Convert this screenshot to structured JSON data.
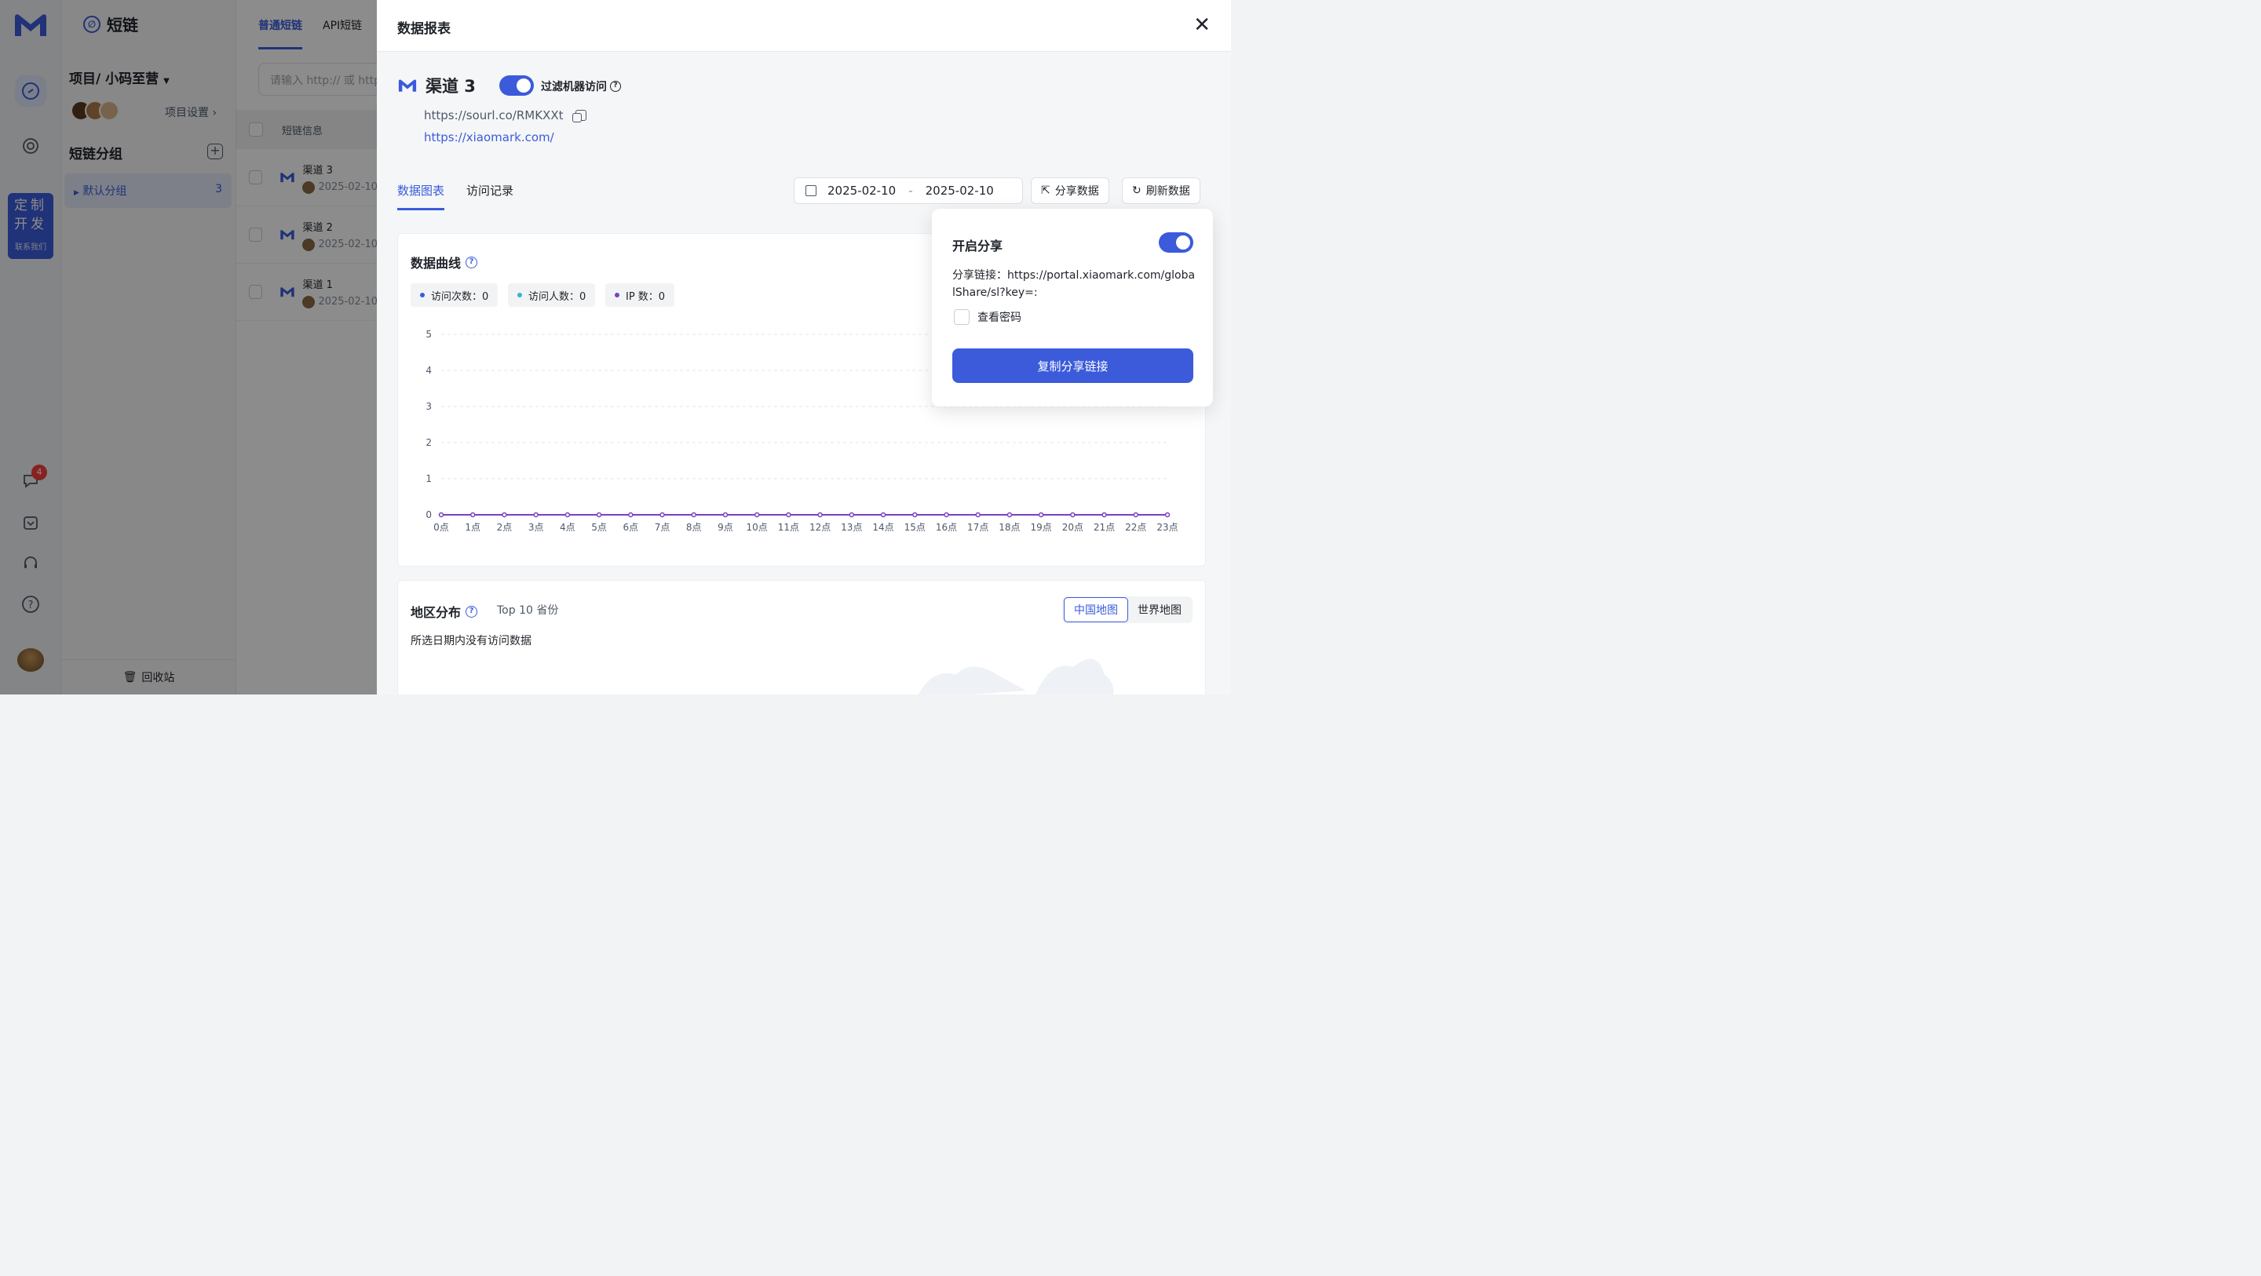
{
  "rail": {
    "custom_title": "定制开发",
    "custom_sub": "联系我们",
    "notification_count": "4"
  },
  "project_panel": {
    "brand": "短链",
    "project_title": "项目/ 小码至营",
    "project_settings": "项目设置",
    "groups_title": "短链分组",
    "default_group": {
      "label": "默认分组",
      "count": "3"
    },
    "trash": "回收站"
  },
  "link_list": {
    "tabs": [
      "普通短链",
      "API短链"
    ],
    "search_placeholder": "请输入 http:// 或 https://",
    "header": "短链信息",
    "rows": [
      {
        "name": "渠道 3",
        "date": "2025-02-10"
      },
      {
        "name": "渠道 2",
        "date": "2025-02-10"
      },
      {
        "name": "渠道 1",
        "date": "2025-02-10"
      }
    ]
  },
  "drawer": {
    "title": "数据报表",
    "link_name": "渠道 3",
    "filter_label": "过滤机器访问",
    "short_url": "https://sourl.co/RMKXXt",
    "target_url": "https://xiaomark.com/",
    "tabs": [
      "数据图表",
      "访问记录"
    ],
    "date_start": "2025-02-10",
    "date_sep": "-",
    "date_end": "2025-02-10",
    "share_button": "分享数据",
    "refresh_button": "刷新数据"
  },
  "curve_card": {
    "title": "数据曲线",
    "legend": [
      {
        "label": "访问次数：0",
        "color": "#3b5bdb"
      },
      {
        "label": "访问人数：0",
        "color": "#36b6c9"
      },
      {
        "label": "IP 数：0",
        "color": "#7b3fc4"
      }
    ]
  },
  "chart_data": {
    "type": "line",
    "x": [
      "0点",
      "1点",
      "2点",
      "3点",
      "4点",
      "5点",
      "6点",
      "7点",
      "8点",
      "9点",
      "10点",
      "11点",
      "12点",
      "13点",
      "14点",
      "15点",
      "16点",
      "17点",
      "18点",
      "19点",
      "20点",
      "21点",
      "22点",
      "23点"
    ],
    "series": [
      {
        "name": "访问次数",
        "values": [
          0,
          0,
          0,
          0,
          0,
          0,
          0,
          0,
          0,
          0,
          0,
          0,
          0,
          0,
          0,
          0,
          0,
          0,
          0,
          0,
          0,
          0,
          0,
          0
        ]
      },
      {
        "name": "访问人数",
        "values": [
          0,
          0,
          0,
          0,
          0,
          0,
          0,
          0,
          0,
          0,
          0,
          0,
          0,
          0,
          0,
          0,
          0,
          0,
          0,
          0,
          0,
          0,
          0,
          0
        ]
      },
      {
        "name": "IP 数",
        "values": [
          0,
          0,
          0,
          0,
          0,
          0,
          0,
          0,
          0,
          0,
          0,
          0,
          0,
          0,
          0,
          0,
          0,
          0,
          0,
          0,
          0,
          0,
          0,
          0
        ]
      }
    ],
    "yticks": [
      0,
      1,
      2,
      3,
      4,
      5
    ],
    "ylim": [
      0,
      5
    ],
    "grid": true,
    "line_color": "#7b3fc4"
  },
  "geo_card": {
    "title": "地区分布",
    "subtitle": "Top 10 省份",
    "map_options": [
      "中国地图",
      "世界地图"
    ],
    "empty_text": "所选日期内没有访问数据"
  },
  "share_popover": {
    "title": "开启分享",
    "link_text": "分享链接：https://portal.xiaomark.com/globalShare/sl?key=:",
    "password_label": "查看密码",
    "copy_button": "复制分享链接"
  }
}
